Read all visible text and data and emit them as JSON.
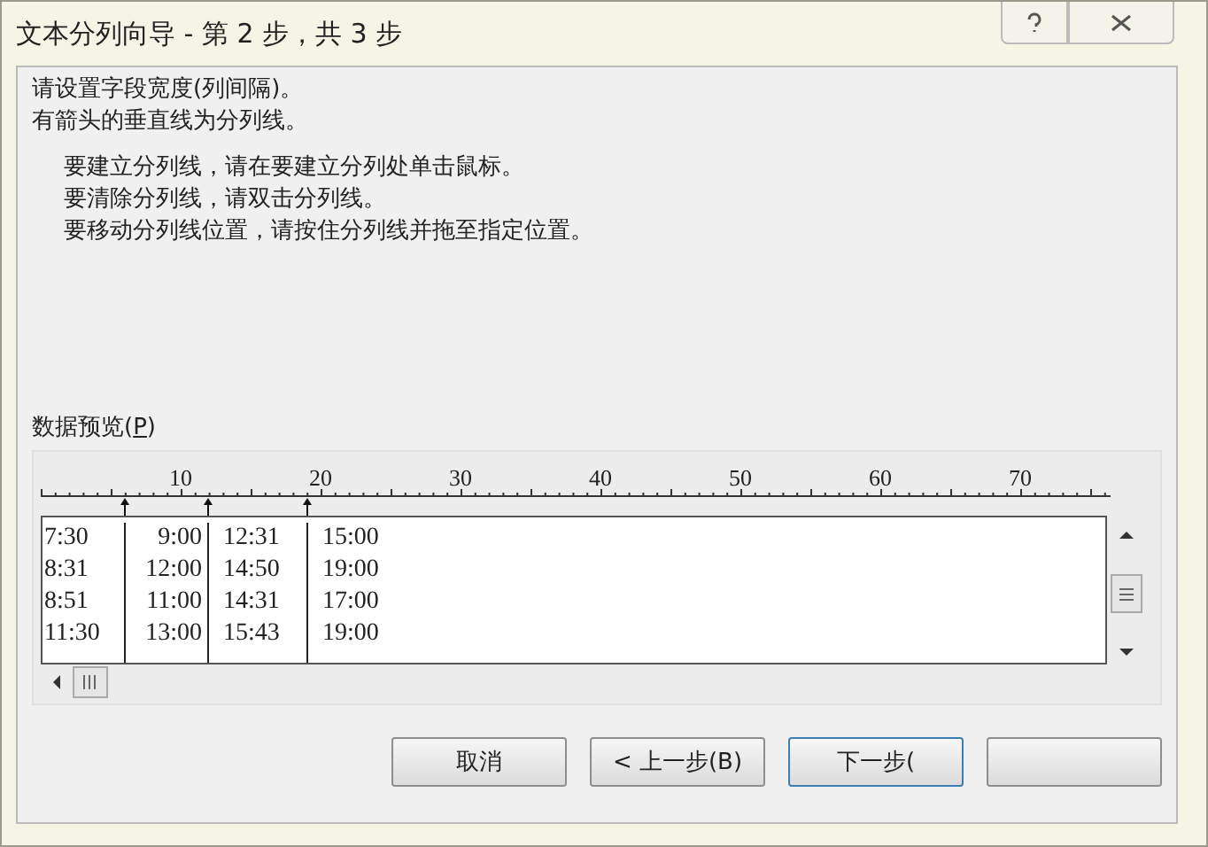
{
  "window": {
    "title": "文本分列向导 - 第 2 步，共 3 步"
  },
  "instructions": [
    "请设置字段宽度(列间隔)。",
    "有箭头的垂直线为分列线。"
  ],
  "hints": [
    "要建立分列线，请在要建立分列处单击鼠标。",
    "要清除分列线，请双击分列线。",
    "要移动分列线位置，请按住分列线并拖至指定位置。"
  ],
  "preview": {
    "label": "数据预览(",
    "mnemonic": "P",
    "label_end": ")",
    "ruler_labels": [
      "10",
      "20",
      "30",
      "40",
      "50",
      "60",
      "70"
    ],
    "columns": [
      [
        "7:30",
        "8:31",
        "8:51",
        "11:30"
      ],
      [
        "9:00",
        "12:00",
        "11:00",
        "13:00"
      ],
      [
        "12:31",
        "14:50",
        "14:31",
        "15:43"
      ],
      [
        "15:00",
        "19:00",
        "17:00",
        "19:00"
      ]
    ]
  },
  "buttons": [
    {
      "label": "取消",
      "kind": "normal"
    },
    {
      "label": "< 上一步(B)",
      "kind": "normal"
    },
    {
      "label": "下一步(",
      "kind": "default"
    },
    {
      "kind": "normal"
    }
  ]
}
